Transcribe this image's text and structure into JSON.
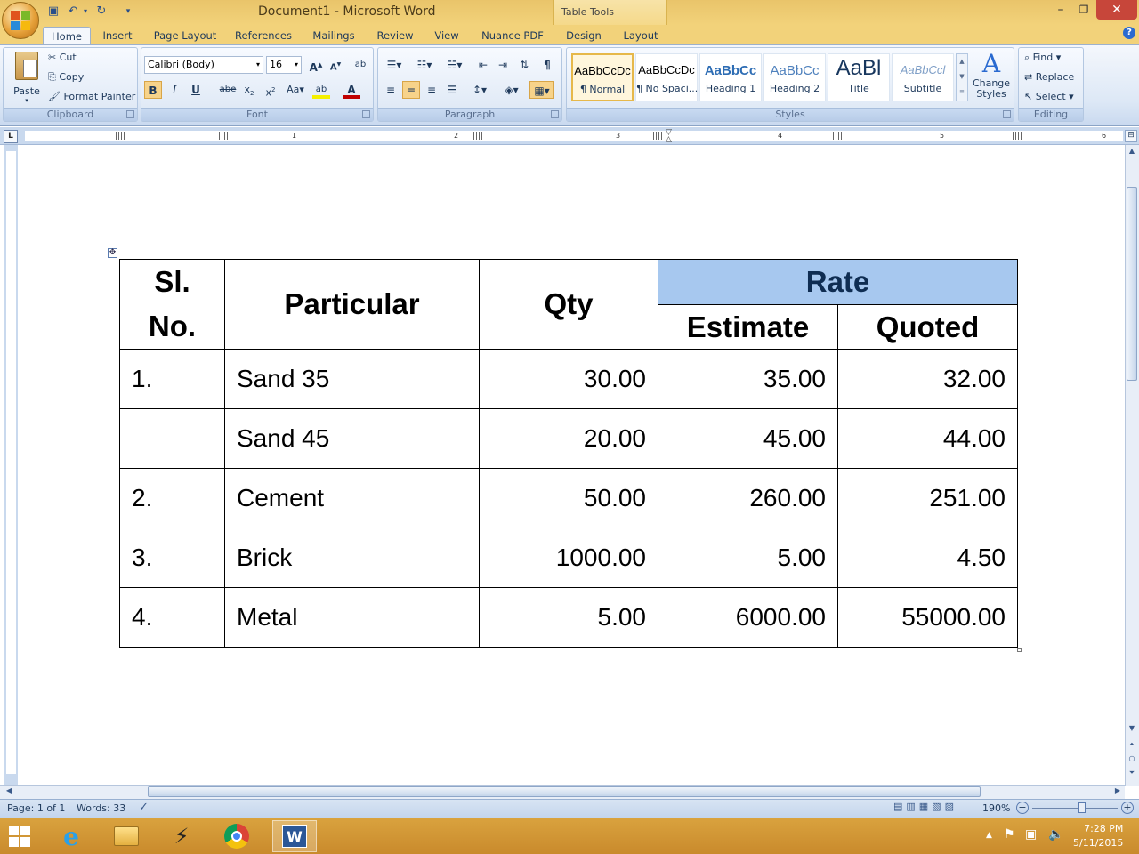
{
  "window": {
    "title": "Document1 - Microsoft Word",
    "contextual_group": "Table Tools"
  },
  "tabs": [
    "Home",
    "Insert",
    "Page Layout",
    "References",
    "Mailings",
    "Review",
    "View",
    "Nuance PDF",
    "Design",
    "Layout"
  ],
  "ribbon": {
    "clipboard": {
      "paste": "Paste",
      "cut": "Cut",
      "copy": "Copy",
      "format_painter": "Format Painter",
      "label": "Clipboard"
    },
    "font": {
      "name": "Calibri (Body)",
      "size": "16",
      "label": "Font"
    },
    "paragraph": {
      "label": "Paragraph"
    },
    "styles": {
      "label": "Styles",
      "items": [
        {
          "sample": "AaBbCcDc",
          "name": "¶ Normal",
          "color": "#000000"
        },
        {
          "sample": "AaBbCcDc",
          "name": "¶ No Spaci...",
          "color": "#000000"
        },
        {
          "sample": "AaBbCc",
          "name": "Heading 1",
          "color": "#2e6db4"
        },
        {
          "sample": "AaBbCc",
          "name": "Heading 2",
          "color": "#4f81bd"
        },
        {
          "sample": "AaBl",
          "name": "Title",
          "color": "#17365d"
        },
        {
          "sample": "AaBbCcl",
          "name": "Subtitle",
          "color": "#7f9fc7"
        }
      ],
      "change_styles": "Change Styles"
    },
    "editing": {
      "find": "Find",
      "replace": "Replace",
      "select": "Select",
      "label": "Editing"
    }
  },
  "ruler": {
    "numbers": [
      "1",
      "2",
      "3",
      "4",
      "5",
      "6"
    ]
  },
  "table": {
    "headers": {
      "sl": "Sl.",
      "no": "No.",
      "particular": "Particular",
      "qty": "Qty",
      "rate": "Rate",
      "estimate": "Estimate",
      "quoted": "Quoted"
    },
    "rows": [
      {
        "sl": "1.",
        "particular": "Sand 35",
        "qty": "30.00",
        "estimate": "35.00",
        "quoted": "32.00"
      },
      {
        "sl": "",
        "particular": "Sand 45",
        "qty": "20.00",
        "estimate": "45.00",
        "quoted": "44.00"
      },
      {
        "sl": "2.",
        "particular": "Cement",
        "qty": "50.00",
        "estimate": "260.00",
        "quoted": "251.00"
      },
      {
        "sl": "3.",
        "particular": "Brick",
        "qty": "1000.00",
        "estimate": "5.00",
        "quoted": "4.50"
      },
      {
        "sl": "4.",
        "particular": "Metal",
        "qty": "5.00",
        "estimate": "6000.00",
        "quoted": "55000.00"
      }
    ]
  },
  "status": {
    "page": "Page: 1 of 1",
    "words": "Words: 33",
    "zoom": "190%"
  },
  "tray": {
    "time": "7:28 PM",
    "date": "5/11/2015"
  },
  "colors": {
    "rate_header_fill": "#a7c8ef",
    "title_bar": "#f2d27a",
    "ribbon": "#dde8f6"
  }
}
